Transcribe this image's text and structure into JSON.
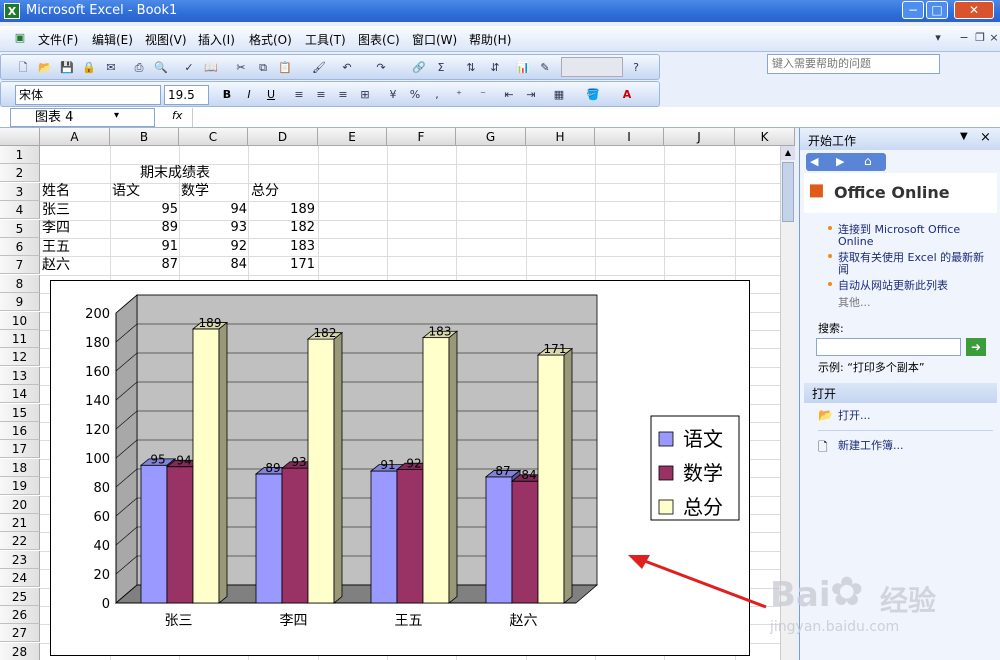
{
  "window": {
    "title": "Microsoft Excel - Book1",
    "min": "−",
    "max": "□",
    "close": "✕"
  },
  "menu": [
    "文件(F)",
    "编辑(E)",
    "视图(V)",
    "插入(I)",
    "格式(O)",
    "工具(T)",
    "图表(C)",
    "窗口(W)",
    "帮助(H)"
  ],
  "help_placeholder": "键入需要帮助的问题",
  "format": {
    "font": "宋体",
    "size": "19.5",
    "bold": "B",
    "italic": "I",
    "underline": "U"
  },
  "formula": {
    "name_box": "图表 4",
    "fx": "fx"
  },
  "columns": [
    "A",
    "B",
    "C",
    "D",
    "E",
    "F",
    "G",
    "H",
    "I",
    "J",
    "K"
  ],
  "rows": [
    "1",
    "2",
    "3",
    "4",
    "5",
    "6",
    "7",
    "8",
    "9",
    "10",
    "11",
    "12",
    "13",
    "14",
    "15",
    "16",
    "17",
    "18",
    "19",
    "20",
    "21",
    "22",
    "23",
    "24",
    "25",
    "26",
    "27",
    "28"
  ],
  "sheet": {
    "title": "期末成绩表",
    "headers": [
      "姓名",
      "语文",
      "数学",
      "总分"
    ],
    "data": [
      {
        "name": "张三",
        "chinese": "95",
        "math": "94",
        "total": "189"
      },
      {
        "name": "李四",
        "chinese": "89",
        "math": "93",
        "total": "182"
      },
      {
        "name": "王五",
        "chinese": "91",
        "math": "92",
        "total": "183"
      },
      {
        "name": "赵六",
        "chinese": "87",
        "math": "84",
        "total": "171"
      }
    ]
  },
  "chart_data": {
    "type": "bar",
    "categories": [
      "张三",
      "李四",
      "王五",
      "赵六"
    ],
    "series": [
      {
        "name": "语文",
        "values": [
          95,
          89,
          91,
          87
        ],
        "color": "#9999ff"
      },
      {
        "name": "数学",
        "values": [
          94,
          93,
          92,
          84
        ],
        "color": "#993366"
      },
      {
        "name": "总分",
        "values": [
          189,
          182,
          183,
          171
        ],
        "color": "#ffffcc"
      }
    ],
    "ylim": [
      0,
      200
    ],
    "yticks": [
      "0",
      "20",
      "40",
      "60",
      "80",
      "100",
      "120",
      "140",
      "160",
      "180",
      "200"
    ],
    "grid": true,
    "legend": "right",
    "style": "3d-clustered-column"
  },
  "taskpane": {
    "title": "开始工作",
    "office_online": "Office Online",
    "links": [
      "连接到 Microsoft Office Online",
      "获取有关使用 Excel 的最新新闻",
      "自动从网站更新此列表"
    ],
    "more": "其他...",
    "search_label": "搜索:",
    "example": "示例: “打印多个副本”",
    "open_header": "打开",
    "open_link": "打开...",
    "new_workbook": "新建工作簿..."
  },
  "watermark": {
    "brand": "Bai",
    "brand2": "经验",
    "url": "jingyan.baidu.com"
  }
}
